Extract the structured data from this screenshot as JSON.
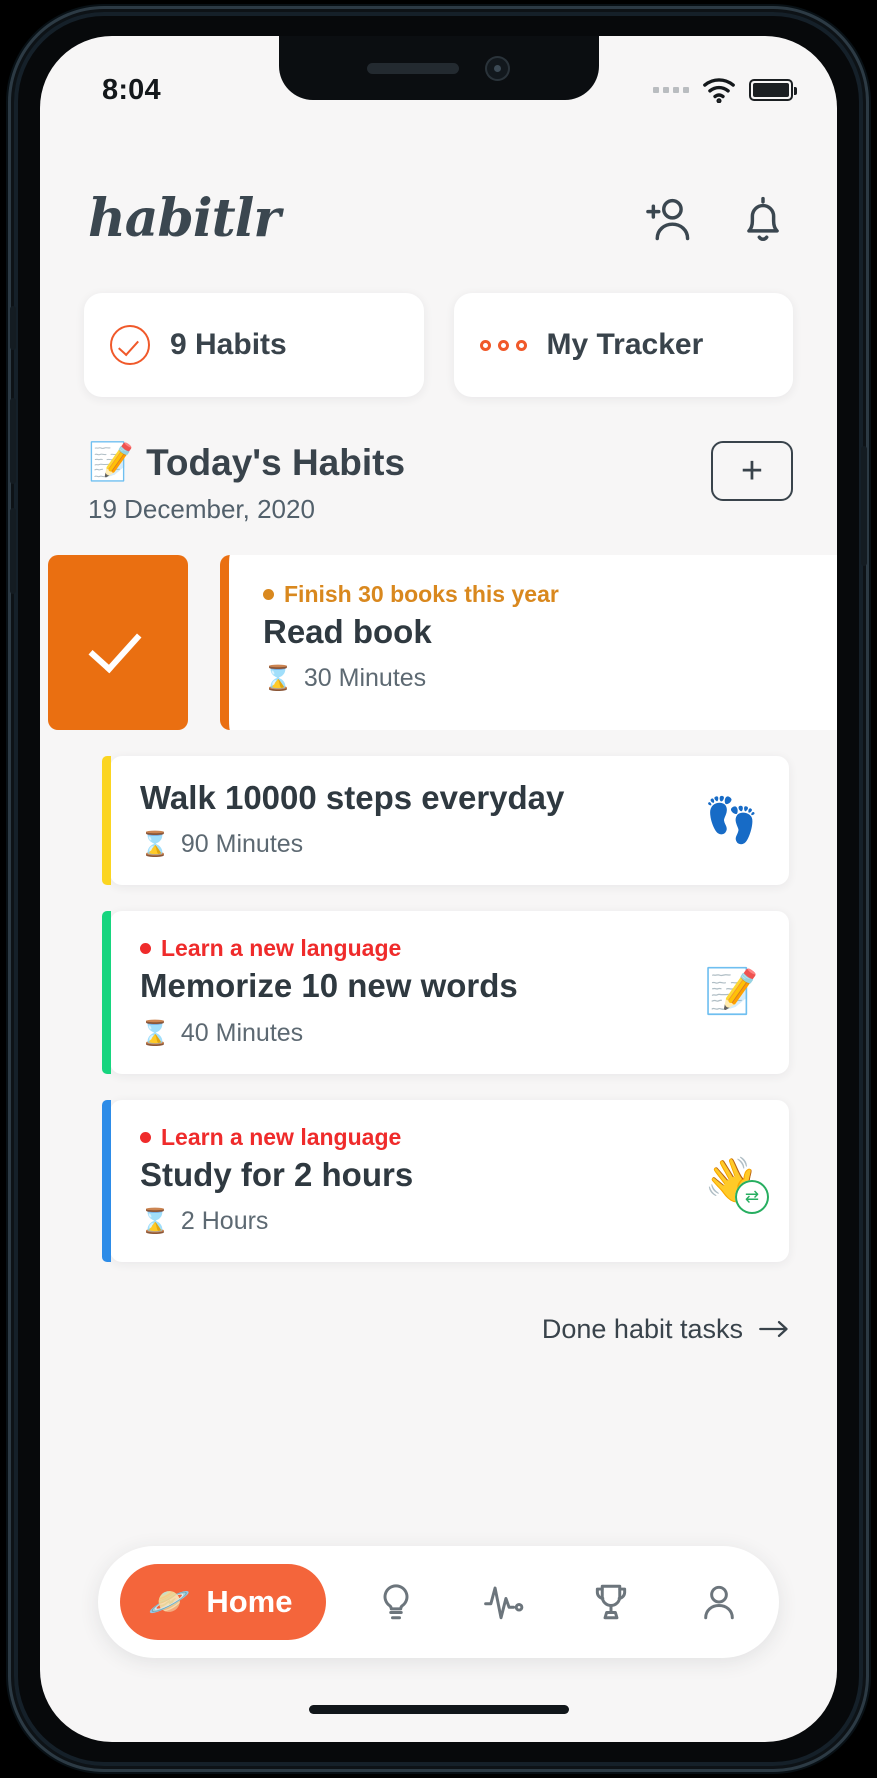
{
  "status_bar": {
    "time": "8:04",
    "signal_icon": "signal-dots-icon",
    "wifi_icon": "wifi-icon",
    "battery_icon": "battery-full-icon"
  },
  "header": {
    "logo": "habitlr",
    "add_friend_icon": "add-person-icon",
    "notification_icon": "bell-icon"
  },
  "stats": [
    {
      "label": "9 Habits",
      "icon": "check-circle-icon"
    },
    {
      "label": "My Tracker",
      "icon": "three-dots-icon"
    }
  ],
  "section": {
    "emoji": "📝",
    "title": "Today's Habits",
    "date": "19 December, 2020",
    "add_button_label": "+"
  },
  "habits": [
    {
      "goal": "Finish 30 books this year",
      "goal_color": "#d9881e",
      "title": "Read book",
      "duration": "30 Minutes",
      "stripe_color": "#ea6f11",
      "emoji": "",
      "swiped": true,
      "swipe_action": "complete"
    },
    {
      "goal": "",
      "goal_color": "",
      "title": "Walk 10000 steps everyday",
      "duration": "90 Minutes",
      "stripe_color": "#fbd521",
      "emoji": "👣",
      "swiped": false
    },
    {
      "goal": "Learn a new language",
      "goal_color": "#ef2b2b",
      "title": "Memorize 10 new words",
      "duration": "40 Minutes",
      "stripe_color": "#17d57f",
      "emoji": "📝",
      "swiped": false
    },
    {
      "goal": "Learn a new language",
      "goal_color": "#ef2b2b",
      "title": "Study for 2 hours",
      "duration": "2 Hours",
      "stripe_color": "#2d8ce8",
      "emoji": "👋",
      "swiped": false,
      "badge": "repeat"
    }
  ],
  "done_link": {
    "label": "Done habit tasks",
    "icon": "arrow-right-icon"
  },
  "bottom_nav": {
    "active": "Home",
    "home_label": "Home",
    "home_emoji": "🪐",
    "items": [
      {
        "name": "home",
        "label": "Home",
        "icon": "planet-icon"
      },
      {
        "name": "ideas",
        "label": "",
        "icon": "lightbulb-icon"
      },
      {
        "name": "activity",
        "label": "",
        "icon": "pulse-icon"
      },
      {
        "name": "achievements",
        "label": "",
        "icon": "trophy-icon"
      },
      {
        "name": "profile",
        "label": "",
        "icon": "person-icon"
      }
    ]
  },
  "colors": {
    "accent": "#f0592a",
    "home_pill": "#f4653b",
    "background": "#f7f6f6",
    "text_dark": "#39434b"
  }
}
